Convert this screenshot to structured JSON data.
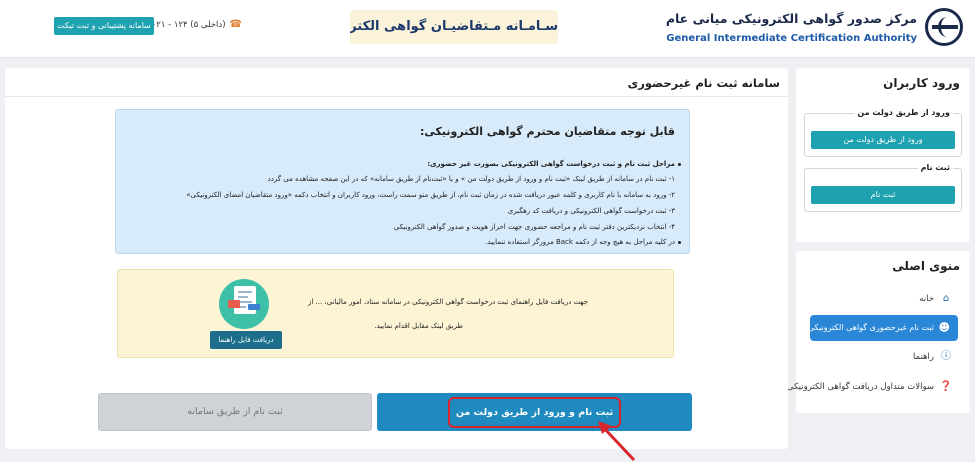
{
  "header": {
    "org_name_fa": "مرکز صدور گواهی الکترونیکی میانی عام",
    "org_name_en": "General Intermediate Certification Authority",
    "system_title": "سـامـانه مـتقاضیـان گواهی الکترونیکی",
    "phone": "(داخلی ۵) ۱۲۴ - ۰۲۱",
    "support_button": "سامانه پشتیبانی و ثبت تیکت"
  },
  "sidebar": {
    "login_title": "ورود کاربران",
    "dolat_group_label": "ورود از طریق دولت من",
    "dolat_login_button": "ورود از طریق دولت من",
    "register_group_label": "ثبت نام",
    "register_button": "ثبت نام",
    "menu_title": "منوی اصلی",
    "menu_items": [
      {
        "label": "خانه",
        "icon": "home-icon"
      },
      {
        "label": "ثبت نام غیرحضوری گواهی الکترونیکی",
        "icon": "add-user-icon"
      },
      {
        "label": "راهنما",
        "icon": "info-icon"
      },
      {
        "label": "سوالات متداول دریافت گواهی الکترونیکی",
        "icon": "question-icon"
      }
    ]
  },
  "main": {
    "title": "سامانه ثبت نام غیرحضوری",
    "info": {
      "heading": "قابل توجه متقاضیان محترم گواهی الکترونیکی:",
      "subheading": "مراحل ثبت نام و ثبت درخواست گواهی الکترونیکی بصورت غیر حضوری:",
      "lines": [
        "۱- ثبت نام در سامانه از طریق لینک «ثبت نام و ورود از طریق دولت من » و یا «ثبت‌نام از طریق سامانه» که در این صفحه مشاهده می گردد",
        "۲- ورود به سامانه با نام کاربری و کلمه عبور دریافت شده در زمان ثبت نام، از طریق منو سمت راست، ورود کاربران و انتخاب دکمه «ورود متقاضیان امضای الکترونیکی»",
        "۳- ثبت درخواست گواهی الکترونیکی و دریافت کد رهگیری",
        "۴- انتخاب نزدیکترین دفتر ثبت نام و مراجعه حضوری جهت احراز هویت و صدور گواهی الکترونیکی"
      ],
      "note": "در کلیه مراحل به هیچ وجه از دکمه Back مرورگر استفاده ننمایید."
    },
    "notice": {
      "text1": "جهت دریافت فایل راهنمای ثبت درخواست گواهی الکترونیکی در سامانه ستاد، امور مالیاتی، ... از",
      "text2": "طریق لینک مقابل اقدام نمایید.",
      "guide_button": "دریافت فایل راهنما"
    },
    "btn_system": "ثبت نام از طریق سامانه",
    "btn_dolat": "ثبت نام و ورود از طریق دولت من"
  },
  "colors": {
    "teal": "#1fa2b0",
    "primary_blue": "#1f8ac0",
    "highlight_red": "#d8252c",
    "menu_active": "#2a87d8"
  }
}
